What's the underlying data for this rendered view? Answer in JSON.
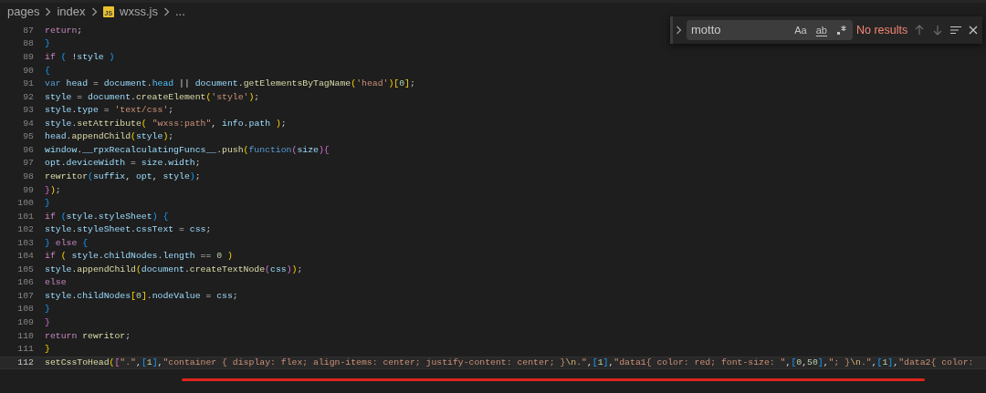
{
  "breadcrumbs": {
    "items": [
      {
        "label": "pages",
        "kind": "folder"
      },
      {
        "label": "index",
        "kind": "folder"
      },
      {
        "label": "wxss.js",
        "kind": "file",
        "badge": "JS"
      },
      {
        "label": "...",
        "kind": "more"
      }
    ]
  },
  "find_widget": {
    "value": "motto",
    "options": [
      {
        "label": "Aa",
        "on": false,
        "kind": "case"
      },
      {
        "label": "ab",
        "on": false,
        "kind": "word"
      },
      {
        "kind": "regex",
        "on": false
      }
    ],
    "status": "No results"
  },
  "editor": {
    "lines": [
      {
        "number": "87",
        "current": false,
        "tokens": [
          {
            "text": "return",
            "kind": "keyword"
          },
          {
            "text": ";",
            "kind": "plain"
          }
        ]
      },
      {
        "number": "88",
        "current": false,
        "tokens": [
          {
            "text": "}",
            "kind": "bracket3"
          }
        ]
      },
      {
        "number": "89",
        "current": false,
        "tokens": [
          {
            "text": "if ",
            "kind": "keyword"
          },
          {
            "text": "(",
            "kind": "bracket3"
          },
          {
            "text": " !",
            "kind": "plain"
          },
          {
            "text": "style ",
            "kind": "variable"
          },
          {
            "text": ")",
            "kind": "bracket3"
          }
        ]
      },
      {
        "number": "90",
        "current": false,
        "tokens": [
          {
            "text": "{",
            "kind": "bracket3"
          }
        ]
      },
      {
        "number": "91",
        "current": false,
        "tokens": [
          {
            "text": "var ",
            "kind": "declaration"
          },
          {
            "text": "head",
            "kind": "variable"
          },
          {
            "text": " = ",
            "kind": "plain"
          },
          {
            "text": "document",
            "kind": "variable"
          },
          {
            "text": ".",
            "kind": "plain"
          },
          {
            "text": "head",
            "kind": "constant"
          },
          {
            "text": " || ",
            "kind": "plain"
          },
          {
            "text": "document",
            "kind": "variable"
          },
          {
            "text": ".",
            "kind": "plain"
          },
          {
            "text": "getElementsByTagName",
            "kind": "function"
          },
          {
            "text": "(",
            "kind": "bracket1"
          },
          {
            "text": "'head'",
            "kind": "string"
          },
          {
            "text": ")",
            "kind": "bracket1"
          },
          {
            "text": "[",
            "kind": "bracket1"
          },
          {
            "text": "0",
            "kind": "number"
          },
          {
            "text": "]",
            "kind": "bracket1"
          },
          {
            "text": ";",
            "kind": "plain"
          }
        ]
      },
      {
        "number": "92",
        "current": false,
        "tokens": [
          {
            "text": "style",
            "kind": "variable"
          },
          {
            "text": " = ",
            "kind": "plain"
          },
          {
            "text": "document",
            "kind": "variable"
          },
          {
            "text": ".",
            "kind": "plain"
          },
          {
            "text": "createElement",
            "kind": "function"
          },
          {
            "text": "(",
            "kind": "bracket1"
          },
          {
            "text": "'style'",
            "kind": "string"
          },
          {
            "text": ")",
            "kind": "bracket1"
          },
          {
            "text": ";",
            "kind": "plain"
          }
        ]
      },
      {
        "number": "93",
        "current": false,
        "tokens": [
          {
            "text": "style",
            "kind": "variable"
          },
          {
            "text": ".",
            "kind": "plain"
          },
          {
            "text": "type",
            "kind": "variable"
          },
          {
            "text": " = ",
            "kind": "plain"
          },
          {
            "text": "'text/css'",
            "kind": "string"
          },
          {
            "text": ";",
            "kind": "plain"
          }
        ]
      },
      {
        "number": "94",
        "current": false,
        "tokens": [
          {
            "text": "style",
            "kind": "variable"
          },
          {
            "text": ".",
            "kind": "plain"
          },
          {
            "text": "setAttribute",
            "kind": "function"
          },
          {
            "text": "(",
            "kind": "bracket1"
          },
          {
            "text": " \"wxss:path\"",
            "kind": "string"
          },
          {
            "text": ", ",
            "kind": "plain"
          },
          {
            "text": "info",
            "kind": "variable"
          },
          {
            "text": ".",
            "kind": "plain"
          },
          {
            "text": "path ",
            "kind": "variable"
          },
          {
            "text": ")",
            "kind": "bracket1"
          },
          {
            "text": ";",
            "kind": "plain"
          }
        ]
      },
      {
        "number": "95",
        "current": false,
        "tokens": [
          {
            "text": "head",
            "kind": "variable"
          },
          {
            "text": ".",
            "kind": "plain"
          },
          {
            "text": "appendChild",
            "kind": "function"
          },
          {
            "text": "(",
            "kind": "bracket1"
          },
          {
            "text": "style",
            "kind": "variable"
          },
          {
            "text": ")",
            "kind": "bracket1"
          },
          {
            "text": ";",
            "kind": "plain"
          }
        ]
      },
      {
        "number": "96",
        "current": false,
        "tokens": [
          {
            "text": "window",
            "kind": "variable"
          },
          {
            "text": ".",
            "kind": "plain"
          },
          {
            "text": "__rpxRecalculatingFuncs__",
            "kind": "variable"
          },
          {
            "text": ".",
            "kind": "plain"
          },
          {
            "text": "push",
            "kind": "function"
          },
          {
            "text": "(",
            "kind": "bracket1"
          },
          {
            "text": "function",
            "kind": "declaration"
          },
          {
            "text": "(",
            "kind": "bracket2"
          },
          {
            "text": "size",
            "kind": "variable"
          },
          {
            "text": ")",
            "kind": "bracket2"
          },
          {
            "text": "{",
            "kind": "bracket2"
          }
        ]
      },
      {
        "number": "97",
        "current": false,
        "tokens": [
          {
            "text": "opt",
            "kind": "variable"
          },
          {
            "text": ".",
            "kind": "plain"
          },
          {
            "text": "deviceWidth",
            "kind": "variable"
          },
          {
            "text": " = ",
            "kind": "plain"
          },
          {
            "text": "size",
            "kind": "variable"
          },
          {
            "text": ".",
            "kind": "plain"
          },
          {
            "text": "width",
            "kind": "variable"
          },
          {
            "text": ";",
            "kind": "plain"
          }
        ]
      },
      {
        "number": "98",
        "current": false,
        "tokens": [
          {
            "text": "rewritor",
            "kind": "function"
          },
          {
            "text": "(",
            "kind": "bracket3"
          },
          {
            "text": "suffix",
            "kind": "variable"
          },
          {
            "text": ", ",
            "kind": "plain"
          },
          {
            "text": "opt",
            "kind": "variable"
          },
          {
            "text": ", ",
            "kind": "plain"
          },
          {
            "text": "style",
            "kind": "variable"
          },
          {
            "text": ")",
            "kind": "bracket3"
          },
          {
            "text": ";",
            "kind": "plain"
          }
        ]
      },
      {
        "number": "99",
        "current": false,
        "tokens": [
          {
            "text": "}",
            "kind": "bracket2"
          },
          {
            "text": ")",
            "kind": "bracket1"
          },
          {
            "text": ";",
            "kind": "plain"
          }
        ]
      },
      {
        "number": "100",
        "current": false,
        "tokens": [
          {
            "text": "}",
            "kind": "bracket3"
          }
        ]
      },
      {
        "number": "101",
        "current": false,
        "tokens": [
          {
            "text": "if ",
            "kind": "keyword"
          },
          {
            "text": "(",
            "kind": "bracket3"
          },
          {
            "text": "style",
            "kind": "variable"
          },
          {
            "text": ".",
            "kind": "plain"
          },
          {
            "text": "styleSheet",
            "kind": "variable"
          },
          {
            "text": ")",
            "kind": "bracket3"
          },
          {
            "text": " {",
            "kind": "bracket3"
          }
        ]
      },
      {
        "number": "102",
        "current": false,
        "tokens": [
          {
            "text": "style",
            "kind": "variable"
          },
          {
            "text": ".",
            "kind": "plain"
          },
          {
            "text": "styleSheet",
            "kind": "variable"
          },
          {
            "text": ".",
            "kind": "plain"
          },
          {
            "text": "cssText",
            "kind": "variable"
          },
          {
            "text": " = ",
            "kind": "plain"
          },
          {
            "text": "css",
            "kind": "variable"
          },
          {
            "text": ";",
            "kind": "plain"
          }
        ]
      },
      {
        "number": "103",
        "current": false,
        "tokens": [
          {
            "text": "} ",
            "kind": "bracket3"
          },
          {
            "text": "else ",
            "kind": "keyword"
          },
          {
            "text": "{",
            "kind": "bracket3"
          }
        ]
      },
      {
        "number": "104",
        "current": false,
        "tokens": [
          {
            "text": "if ",
            "kind": "keyword"
          },
          {
            "text": "(",
            "kind": "bracket1"
          },
          {
            "text": " style",
            "kind": "variable"
          },
          {
            "text": ".",
            "kind": "plain"
          },
          {
            "text": "childNodes",
            "kind": "variable"
          },
          {
            "text": ".",
            "kind": "plain"
          },
          {
            "text": "length",
            "kind": "variable"
          },
          {
            "text": " == ",
            "kind": "plain"
          },
          {
            "text": "0 ",
            "kind": "number"
          },
          {
            "text": ")",
            "kind": "bracket1"
          }
        ]
      },
      {
        "number": "105",
        "current": false,
        "tokens": [
          {
            "text": "style",
            "kind": "variable"
          },
          {
            "text": ".",
            "kind": "plain"
          },
          {
            "text": "appendChild",
            "kind": "function"
          },
          {
            "text": "(",
            "kind": "bracket1"
          },
          {
            "text": "document",
            "kind": "variable"
          },
          {
            "text": ".",
            "kind": "plain"
          },
          {
            "text": "createTextNode",
            "kind": "function"
          },
          {
            "text": "(",
            "kind": "bracket2"
          },
          {
            "text": "css",
            "kind": "variable"
          },
          {
            "text": ")",
            "kind": "bracket2"
          },
          {
            "text": ")",
            "kind": "bracket1"
          },
          {
            "text": ";",
            "kind": "plain"
          }
        ]
      },
      {
        "number": "106",
        "current": false,
        "tokens": [
          {
            "text": "else",
            "kind": "keyword"
          }
        ]
      },
      {
        "number": "107",
        "current": false,
        "tokens": [
          {
            "text": "style",
            "kind": "variable"
          },
          {
            "text": ".",
            "kind": "plain"
          },
          {
            "text": "childNodes",
            "kind": "variable"
          },
          {
            "text": "[",
            "kind": "bracket1"
          },
          {
            "text": "0",
            "kind": "number"
          },
          {
            "text": "]",
            "kind": "bracket1"
          },
          {
            "text": ".",
            "kind": "plain"
          },
          {
            "text": "nodeValue",
            "kind": "variable"
          },
          {
            "text": " = ",
            "kind": "plain"
          },
          {
            "text": "css",
            "kind": "variable"
          },
          {
            "text": ";",
            "kind": "plain"
          }
        ]
      },
      {
        "number": "108",
        "current": false,
        "tokens": [
          {
            "text": "}",
            "kind": "bracket3"
          }
        ]
      },
      {
        "number": "109",
        "current": false,
        "tokens": [
          {
            "text": "}",
            "kind": "bracket2"
          }
        ]
      },
      {
        "number": "110",
        "current": false,
        "tokens": [
          {
            "text": "return ",
            "kind": "keyword"
          },
          {
            "text": "rewritor",
            "kind": "function"
          },
          {
            "text": ";",
            "kind": "plain"
          }
        ]
      },
      {
        "number": "111",
        "current": false,
        "tokens": [
          {
            "text": "}",
            "kind": "bracket1"
          }
        ]
      },
      {
        "number": "112",
        "current": true,
        "tokens": [
          {
            "text": "setCssToHead",
            "kind": "function"
          },
          {
            "text": "(",
            "kind": "bracket1"
          },
          {
            "text": "[",
            "kind": "bracket2"
          },
          {
            "text": "\".\"",
            "kind": "string"
          },
          {
            "text": ",",
            "kind": "plain"
          },
          {
            "text": "[",
            "kind": "bracket3"
          },
          {
            "text": "1",
            "kind": "number"
          },
          {
            "text": "]",
            "kind": "bracket3"
          },
          {
            "text": ",",
            "kind": "plain"
          },
          {
            "text": "\"container { display: flex; align-items: center; justify-content: center; }",
            "kind": "string"
          },
          {
            "text": "\\n",
            "kind": "escape"
          },
          {
            "text": ".\"",
            "kind": "string"
          },
          {
            "text": ",",
            "kind": "plain"
          },
          {
            "text": "[",
            "kind": "bracket3"
          },
          {
            "text": "1",
            "kind": "number"
          },
          {
            "text": "]",
            "kind": "bracket3"
          },
          {
            "text": ",",
            "kind": "plain"
          },
          {
            "text": "\"data1{ color: red; font-size: \"",
            "kind": "string"
          },
          {
            "text": ",",
            "kind": "plain"
          },
          {
            "text": "[",
            "kind": "bracket3"
          },
          {
            "text": "0",
            "kind": "number"
          },
          {
            "text": ",",
            "kind": "plain"
          },
          {
            "text": "50",
            "kind": "number"
          },
          {
            "text": "]",
            "kind": "bracket3"
          },
          {
            "text": ",",
            "kind": "plain"
          },
          {
            "text": "\"; }",
            "kind": "string"
          },
          {
            "text": "\\n",
            "kind": "escape"
          },
          {
            "text": ".\"",
            "kind": "string"
          },
          {
            "text": ",",
            "kind": "plain"
          },
          {
            "text": "[",
            "kind": "bracket3"
          },
          {
            "text": "1",
            "kind": "number"
          },
          {
            "text": "]",
            "kind": "bracket3"
          },
          {
            "text": ",",
            "kind": "plain"
          },
          {
            "text": "\"data2{ color:",
            "kind": "string"
          }
        ]
      }
    ]
  }
}
